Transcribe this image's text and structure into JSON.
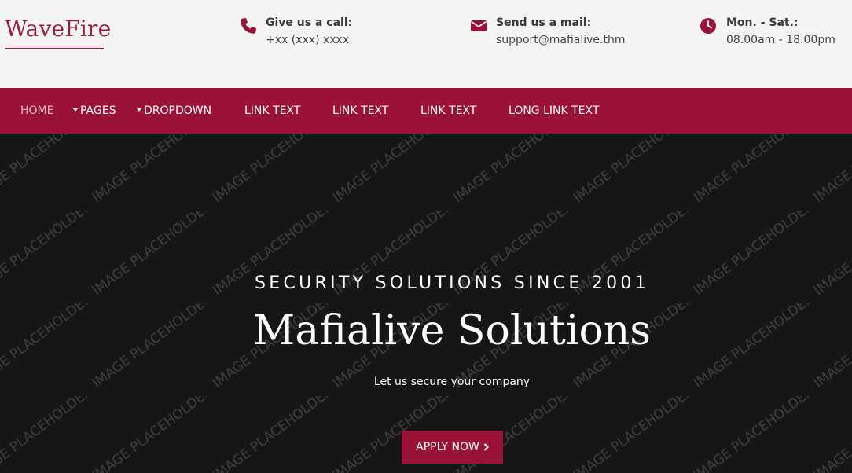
{
  "logo": {
    "text": "WaveFire"
  },
  "contacts": [
    {
      "icon": "phone-icon",
      "title": "Give us a call:",
      "value": "+xx (xxx) xxxx"
    },
    {
      "icon": "mail-icon",
      "title": "Send us a mail:",
      "value": "support@mafialive.thm"
    },
    {
      "icon": "clock-icon",
      "title": "Mon. - Sat.:",
      "value": "08.00am - 18.00pm"
    }
  ],
  "nav": {
    "items": [
      {
        "label": "HOME",
        "active": true
      },
      {
        "label": "PAGES",
        "dropdown": true
      },
      {
        "label": "DROPDOWN",
        "dropdown": true
      },
      {
        "label": "LINK TEXT"
      },
      {
        "label": "LINK TEXT"
      },
      {
        "label": "LINK TEXT"
      },
      {
        "label": "LONG LINK TEXT"
      }
    ]
  },
  "hero": {
    "watermark": "IMAGE PLACEHOLDER",
    "kicker": "SECURITY SOLUTIONS SINCE 2001",
    "title": "Mafialive Solutions",
    "subtitle": "Let us secure your company",
    "button": "APPLY NOW"
  },
  "colors": {
    "brand": "#9b1238",
    "topbar_bg": "#f4f4f4",
    "hero_bg": "#161616"
  }
}
